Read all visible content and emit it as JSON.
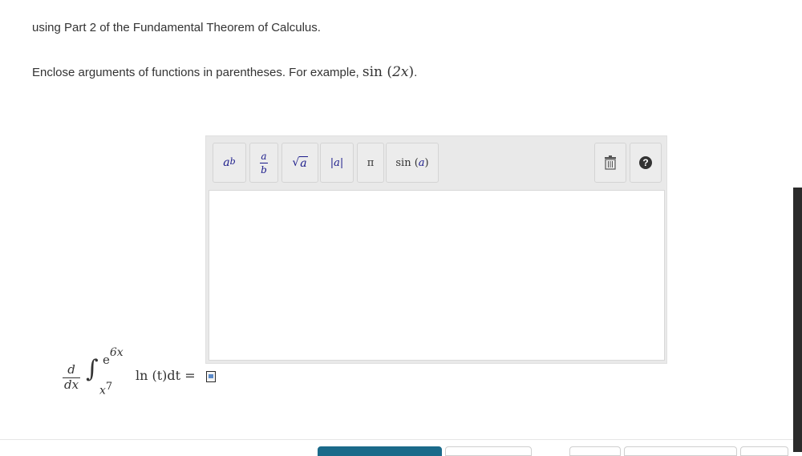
{
  "instructions": {
    "line1": "using Part 2 of the Fundamental Theorem of Calculus.",
    "line2_prefix": "Enclose arguments of functions in parentheses. For example, ",
    "example_fn": "sin",
    "example_arg": "2x",
    "line2_suffix": "."
  },
  "toolbar": {
    "power": {
      "base": "a",
      "exp": "b"
    },
    "fraction": {
      "num": "a",
      "den": "b"
    },
    "sqrt": {
      "symbol": "√",
      "arg": "a"
    },
    "abs": {
      "label": "|a|"
    },
    "pi": {
      "label": "π"
    },
    "sin": {
      "fn": "sin",
      "arg": "a"
    },
    "trash_icon": "trash-icon",
    "help_icon": "help-icon",
    "help_label": "?"
  },
  "answer_input": {
    "value": ""
  },
  "expression": {
    "deriv_num": "d",
    "deriv_den": "dx",
    "integral_sign": "∫",
    "upper_base": "e",
    "upper_exp": "6x",
    "lower_base": "x",
    "lower_exp": "7",
    "integrand": "ln (t)dt",
    "equals": "="
  },
  "colors": {
    "accent": "#1a6a8a",
    "math_blue": "#1a1a8a"
  }
}
